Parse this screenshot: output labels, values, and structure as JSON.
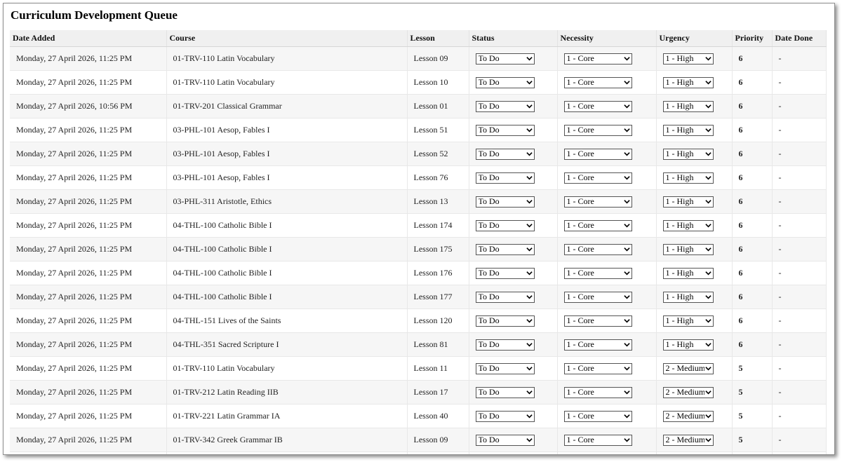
{
  "page": {
    "title": "Curriculum Development Queue"
  },
  "icons": {
    "select_arrow": "chevron-down-icon"
  },
  "table": {
    "headers": {
      "date_added": "Date Added",
      "course": "Course",
      "lesson": "Lesson",
      "status": "Status",
      "necessity": "Necessity",
      "urgency": "Urgency",
      "priority": "Priority",
      "date_done": "Date Done"
    },
    "rows": [
      {
        "date_added": "Monday, 27 April 2026, 11:25 PM",
        "course": "01-TRV-110 Latin Vocabulary",
        "lesson": "Lesson 09",
        "status": "To Do",
        "necessity": "1 - Core",
        "urgency": "1 - High",
        "priority": "6",
        "date_done": "-"
      },
      {
        "date_added": "Monday, 27 April 2026, 11:25 PM",
        "course": "01-TRV-110 Latin Vocabulary",
        "lesson": "Lesson 10",
        "status": "To Do",
        "necessity": "1 - Core",
        "urgency": "1 - High",
        "priority": "6",
        "date_done": "-"
      },
      {
        "date_added": "Monday, 27 April 2026, 10:56 PM",
        "course": "01-TRV-201 Classical Grammar",
        "lesson": "Lesson 01",
        "status": "To Do",
        "necessity": "1 - Core",
        "urgency": "1 - High",
        "priority": "6",
        "date_done": "-"
      },
      {
        "date_added": "Monday, 27 April 2026, 11:25 PM",
        "course": "03-PHL-101 Aesop, Fables I",
        "lesson": "Lesson 51",
        "status": "To Do",
        "necessity": "1 - Core",
        "urgency": "1 - High",
        "priority": "6",
        "date_done": "-"
      },
      {
        "date_added": "Monday, 27 April 2026, 11:25 PM",
        "course": "03-PHL-101 Aesop, Fables I",
        "lesson": "Lesson 52",
        "status": "To Do",
        "necessity": "1 - Core",
        "urgency": "1 - High",
        "priority": "6",
        "date_done": "-"
      },
      {
        "date_added": "Monday, 27 April 2026, 11:25 PM",
        "course": "03-PHL-101 Aesop, Fables I",
        "lesson": "Lesson 76",
        "status": "To Do",
        "necessity": "1 - Core",
        "urgency": "1 - High",
        "priority": "6",
        "date_done": "-"
      },
      {
        "date_added": "Monday, 27 April 2026, 11:25 PM",
        "course": "03-PHL-311 Aristotle, Ethics",
        "lesson": "Lesson 13",
        "status": "To Do",
        "necessity": "1 - Core",
        "urgency": "1 - High",
        "priority": "6",
        "date_done": "-"
      },
      {
        "date_added": "Monday, 27 April 2026, 11:25 PM",
        "course": "04-THL-100 Catholic Bible I",
        "lesson": "Lesson 174",
        "status": "To Do",
        "necessity": "1 - Core",
        "urgency": "1 - High",
        "priority": "6",
        "date_done": "-"
      },
      {
        "date_added": "Monday, 27 April 2026, 11:25 PM",
        "course": "04-THL-100 Catholic Bible I",
        "lesson": "Lesson 175",
        "status": "To Do",
        "necessity": "1 - Core",
        "urgency": "1 - High",
        "priority": "6",
        "date_done": "-"
      },
      {
        "date_added": "Monday, 27 April 2026, 11:25 PM",
        "course": "04-THL-100 Catholic Bible I",
        "lesson": "Lesson 176",
        "status": "To Do",
        "necessity": "1 - Core",
        "urgency": "1 - High",
        "priority": "6",
        "date_done": "-"
      },
      {
        "date_added": "Monday, 27 April 2026, 11:25 PM",
        "course": "04-THL-100 Catholic Bible I",
        "lesson": "Lesson 177",
        "status": "To Do",
        "necessity": "1 - Core",
        "urgency": "1 - High",
        "priority": "6",
        "date_done": "-"
      },
      {
        "date_added": "Monday, 27 April 2026, 11:25 PM",
        "course": "04-THL-151 Lives of the Saints",
        "lesson": "Lesson 120",
        "status": "To Do",
        "necessity": "1 - Core",
        "urgency": "1 - High",
        "priority": "6",
        "date_done": "-"
      },
      {
        "date_added": "Monday, 27 April 2026, 11:25 PM",
        "course": "04-THL-351 Sacred Scripture I",
        "lesson": "Lesson 81",
        "status": "To Do",
        "necessity": "1 - Core",
        "urgency": "1 - High",
        "priority": "6",
        "date_done": "-"
      },
      {
        "date_added": "Monday, 27 April 2026, 11:25 PM",
        "course": "01-TRV-110 Latin Vocabulary",
        "lesson": "Lesson 11",
        "status": "To Do",
        "necessity": "1 - Core",
        "urgency": "2 - Medium",
        "priority": "5",
        "date_done": "-"
      },
      {
        "date_added": "Monday, 27 April 2026, 11:25 PM",
        "course": "01-TRV-212 Latin Reading IIB",
        "lesson": "Lesson 17",
        "status": "To Do",
        "necessity": "1 - Core",
        "urgency": "2 - Medium",
        "priority": "5",
        "date_done": "-"
      },
      {
        "date_added": "Monday, 27 April 2026, 11:25 PM",
        "course": "01-TRV-221 Latin Grammar IA",
        "lesson": "Lesson 40",
        "status": "To Do",
        "necessity": "1 - Core",
        "urgency": "2 - Medium",
        "priority": "5",
        "date_done": "-"
      },
      {
        "date_added": "Monday, 27 April 2026, 11:25 PM",
        "course": "01-TRV-342 Greek Grammar IB",
        "lesson": "Lesson 09",
        "status": "To Do",
        "necessity": "1 - Core",
        "urgency": "2 - Medium",
        "priority": "5",
        "date_done": "-"
      }
    ]
  }
}
